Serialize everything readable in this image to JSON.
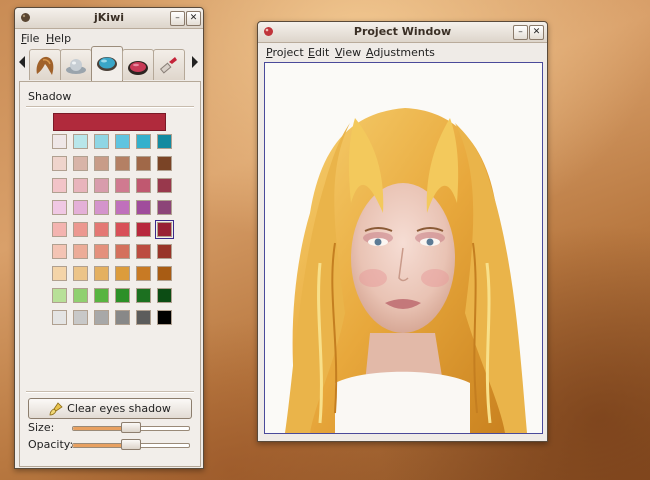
{
  "jkiwi": {
    "title": "jKiwi",
    "menu": [
      "File",
      "Help"
    ],
    "tabs": [
      "hair-icon",
      "hat-icon",
      "eye-shadow-icon",
      "blush-icon",
      "lipstick-icon"
    ],
    "active_tab_index": 2,
    "section_label": "Shadow",
    "selected_color": "#b02a3c",
    "palette": [
      [
        "#efe7e7",
        "#b8e6ea",
        "#8fd6e4",
        "#5fc4e0",
        "#34b0cc",
        "#138aa0"
      ],
      [
        "#efd4cc",
        "#d8b4a8",
        "#c89c88",
        "#b48064",
        "#a06848",
        "#7a4426"
      ],
      [
        "#f2c4c8",
        "#e8b4bc",
        "#d89cac",
        "#d07a90",
        "#c05870",
        "#98384c"
      ],
      [
        "#f0c8e4",
        "#e4b0d8",
        "#d494cc",
        "#c070bc",
        "#a04c9c",
        "#8c4478"
      ],
      [
        "#f4b4b0",
        "#ec9890",
        "#e47874",
        "#d85058",
        "#b8283c",
        "#982034"
      ],
      [
        "#f4c4b4",
        "#ecac98",
        "#e4907c",
        "#d4705c",
        "#bc4c40",
        "#983428"
      ],
      [
        "#f4d4a8",
        "#ecc488",
        "#e4b060",
        "#dc9c3c",
        "#c87a24",
        "#a85c14"
      ],
      [
        "#b8e098",
        "#90d070",
        "#58b440",
        "#2c9028",
        "#1c7020",
        "#0c4c14"
      ],
      [
        "#e4e4e4",
        "#c8c8c8",
        "#a8a8a8",
        "#888888",
        "#5c5c5c",
        "#000000"
      ]
    ],
    "selected_swatch": [
      4,
      5
    ],
    "clear_button_label": "Clear eyes shadow",
    "size_label": "Size:",
    "size_value": 0.5,
    "opacity_label": "Opacity:",
    "opacity_value": 0.5
  },
  "project": {
    "title": "Project Window",
    "menu": [
      "Project",
      "Edit",
      "View",
      "Adjustments"
    ]
  }
}
